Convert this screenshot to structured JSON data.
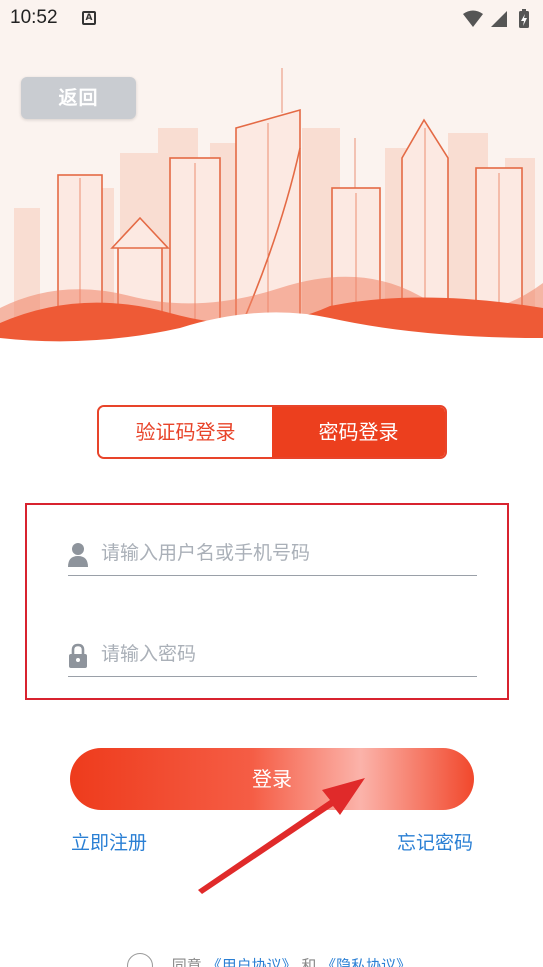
{
  "status_bar": {
    "time": "10:52",
    "notification_icon": "a-icon"
  },
  "header": {
    "back_label": "返回"
  },
  "tabs": [
    {
      "label": "验证码登录",
      "active": false
    },
    {
      "label": "密码登录",
      "active": true
    }
  ],
  "form": {
    "username_placeholder": "请输入用户名或手机号码",
    "password_placeholder": "请输入密码"
  },
  "actions": {
    "login_label": "登录",
    "register_label": "立即注册",
    "forgot_label": "忘记密码"
  },
  "agreement": {
    "prefix": "同意",
    "user_agreement": "《用户协议》",
    "and": "和",
    "privacy_policy": "《隐私协议》"
  },
  "colors": {
    "accent": "#ec3f1e",
    "link": "#2a7fd4",
    "highlight": "#d8232f"
  }
}
